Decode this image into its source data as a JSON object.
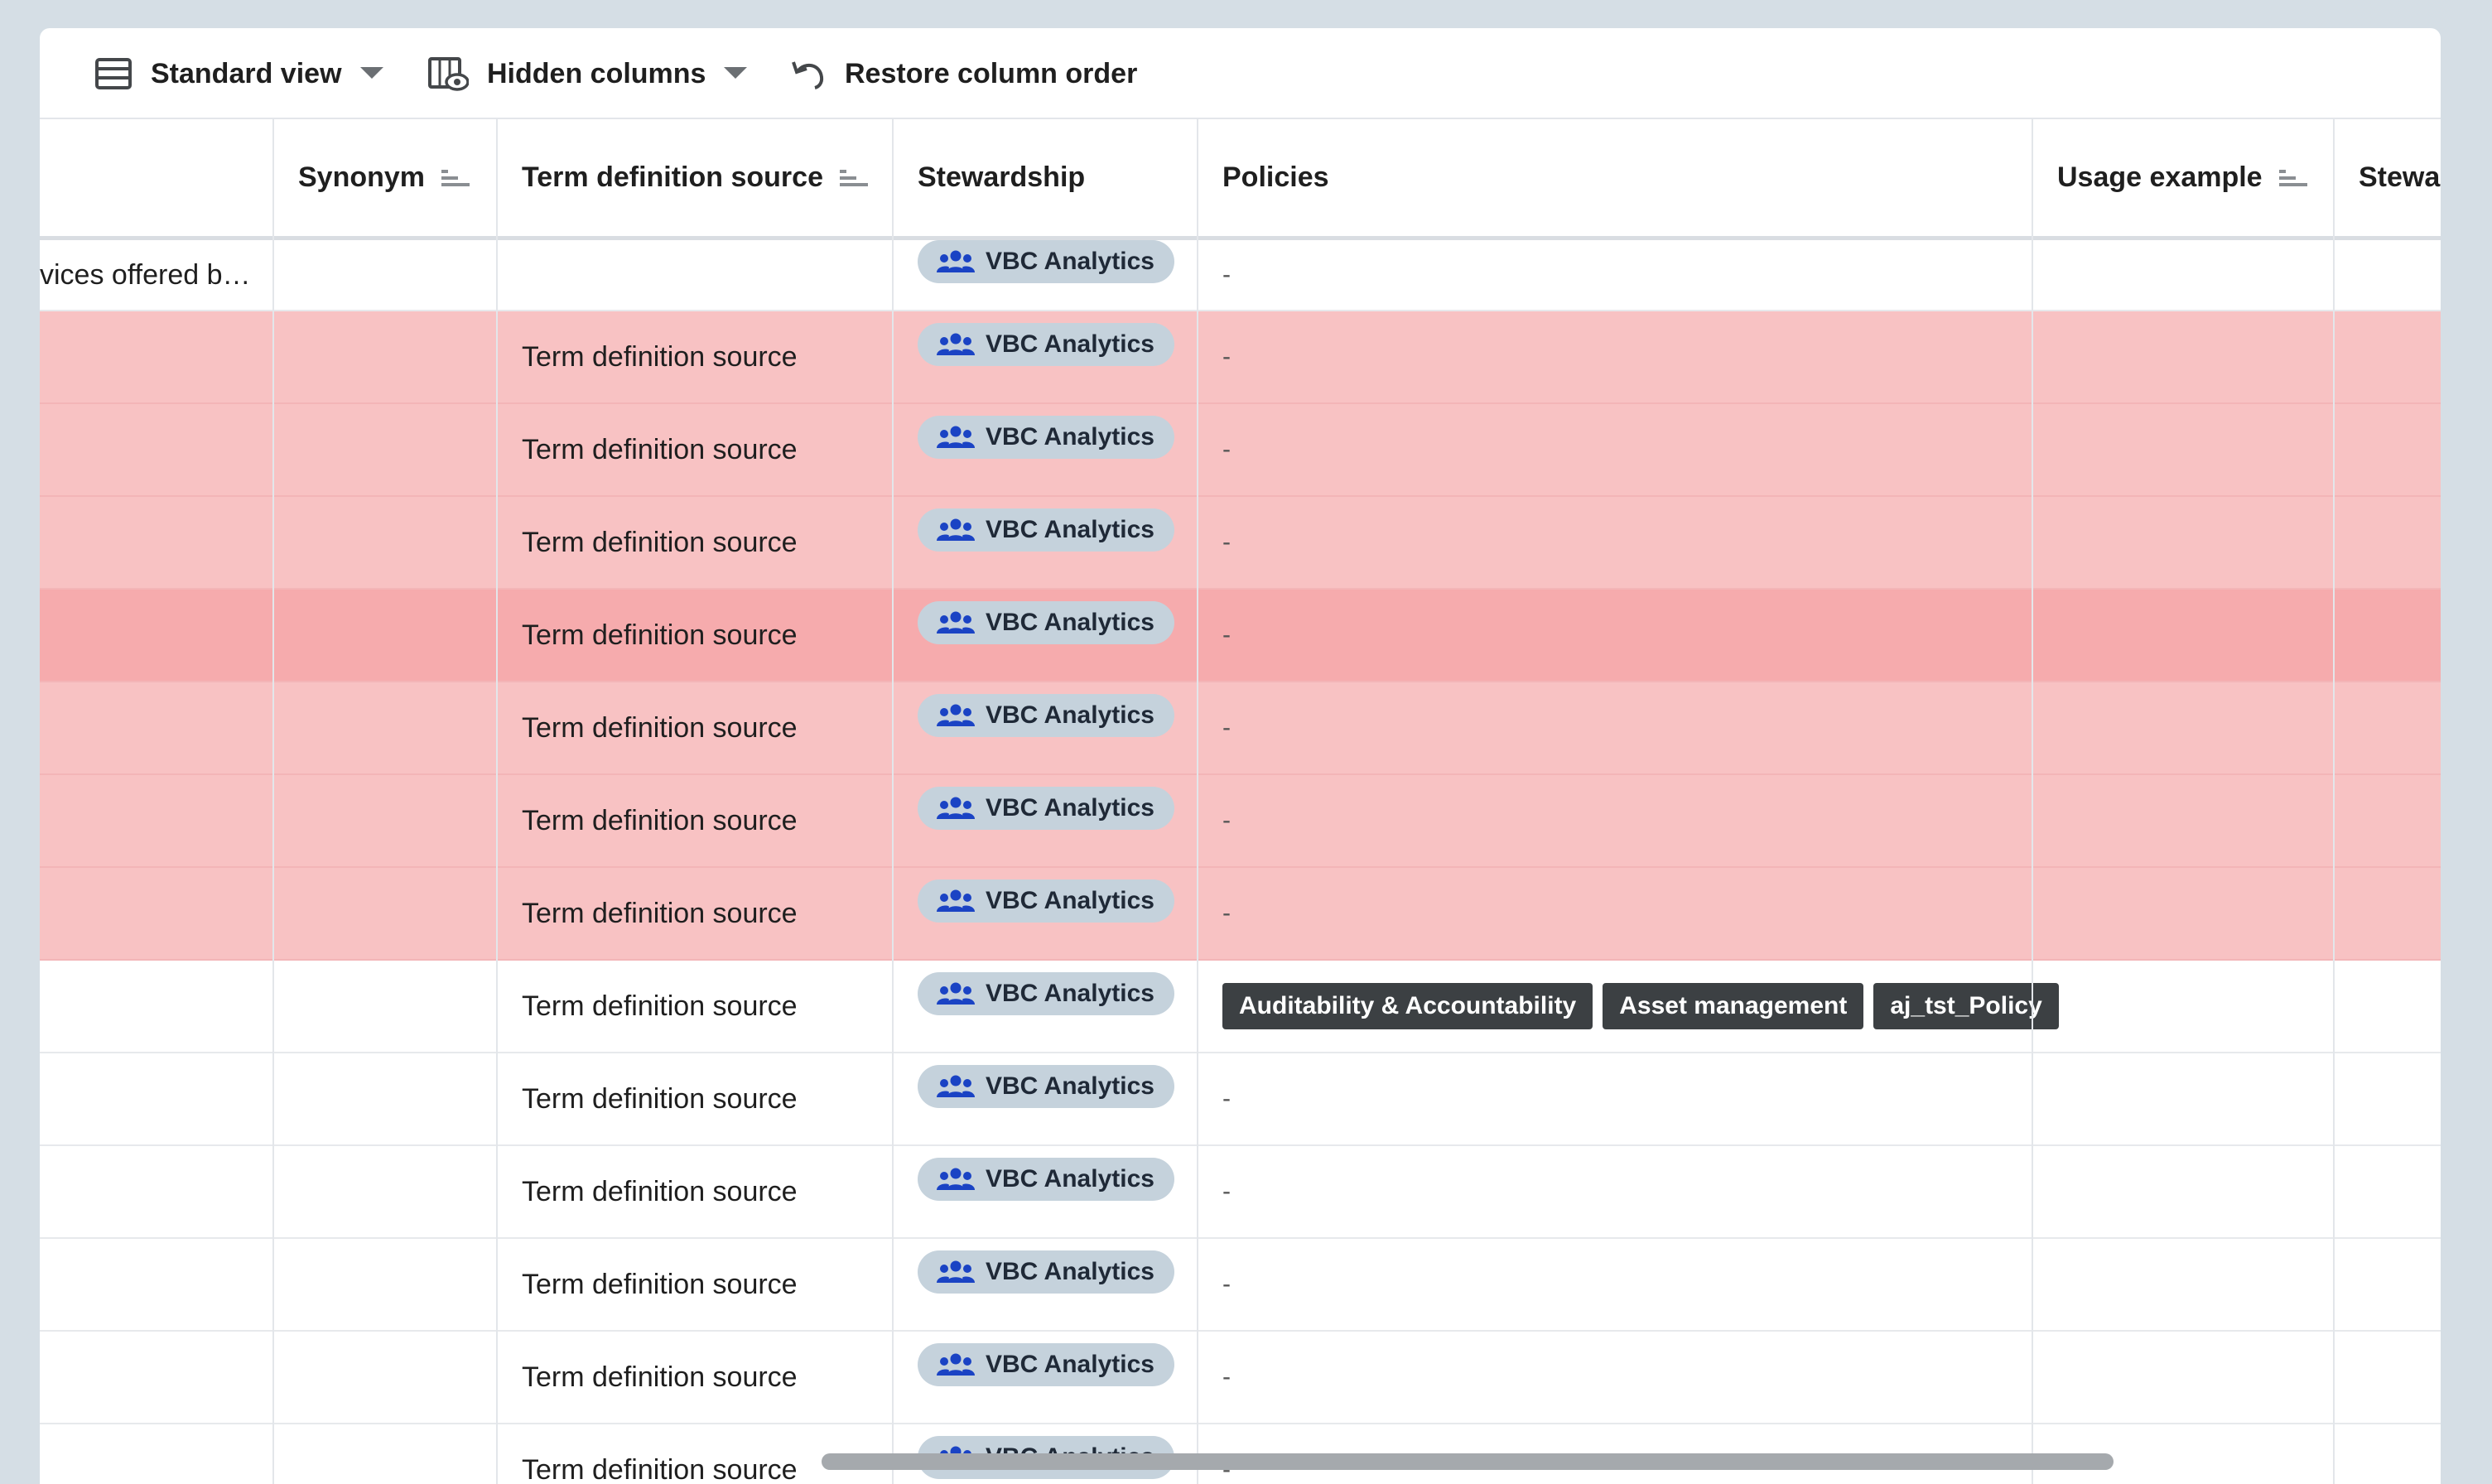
{
  "toolbar": {
    "view_label": "Standard view",
    "hidden_columns_label": "Hidden columns",
    "restore_label": "Restore column order"
  },
  "columns": {
    "synonym": "Synonym",
    "term_definition_source": "Term definition source",
    "stewardship": "Stewardship",
    "policies": "Policies",
    "usage_example": "Usage example",
    "stewa_partial": "Stewa"
  },
  "first_row_partial_text": "vices offered b…",
  "rows": [
    {
      "source": "",
      "steward": "VBC Analytics",
      "policy": "-",
      "bg": "white"
    },
    {
      "source": "Term definition source",
      "steward": "VBC Analytics",
      "policy": "-",
      "bg": "pink"
    },
    {
      "source": "Term definition source",
      "steward": "VBC Analytics",
      "policy": "-",
      "bg": "pink"
    },
    {
      "source": "Term definition source",
      "steward": "VBC Analytics",
      "policy": "-",
      "bg": "pink"
    },
    {
      "source": "Term definition source",
      "steward": "VBC Analytics",
      "policy": "-",
      "bg": "pink-dark"
    },
    {
      "source": "Term definition source",
      "steward": "VBC Analytics",
      "policy": "-",
      "bg": "pink"
    },
    {
      "source": "Term definition source",
      "steward": "VBC Analytics",
      "policy": "-",
      "bg": "pink"
    },
    {
      "source": "Term definition source",
      "steward": "VBC Analytics",
      "policy": "-",
      "bg": "pink"
    },
    {
      "source": "Term definition source",
      "steward": "VBC Analytics",
      "policy": "",
      "bg": "white"
    },
    {
      "source": "Term definition source",
      "steward": "VBC Analytics",
      "policy": "-",
      "bg": "white"
    },
    {
      "source": "Term definition source",
      "steward": "VBC Analytics",
      "policy": "-",
      "bg": "white"
    },
    {
      "source": "Term definition source",
      "steward": "VBC Analytics",
      "policy": "-",
      "bg": "white"
    },
    {
      "source": "Term definition source",
      "steward": "VBC Analytics",
      "policy": "-",
      "bg": "white"
    },
    {
      "source": "Term definition source",
      "steward": "VBC Analytics",
      "policy": "-",
      "bg": "white"
    }
  ],
  "policy_tags": [
    "Auditability & Accountability",
    "Asset management",
    "aj_tst_Policy"
  ],
  "icons": {
    "view": "list-view-icon",
    "hidden": "hidden-columns-icon",
    "restore": "undo-icon",
    "steward": "group-icon",
    "sort": "sort-lines-icon"
  }
}
